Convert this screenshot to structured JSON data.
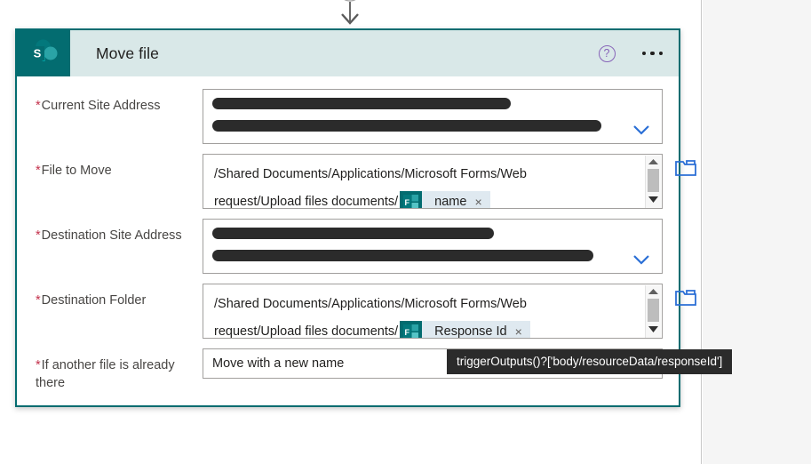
{
  "card": {
    "title": "Move file",
    "connector_icon": "sharepoint-icon",
    "help_glyph": "?",
    "menu_glyph": "overflow-menu-icon",
    "accent_color": "#036c70",
    "header_bg": "#d9e8e8"
  },
  "fields": [
    {
      "id": "current-site-address",
      "label": "Current Site Address",
      "required": true,
      "type": "combo-redacted",
      "value": "",
      "redacted_lines": 2,
      "chevron": "chevron-down-icon"
    },
    {
      "id": "file-to-move",
      "label": "File to Move",
      "required": true,
      "type": "path-token",
      "path_line1": "/Shared Documents/Applications/Microsoft Forms/Web",
      "path_line2": "request/Upload files documents/",
      "token_label": "name",
      "token_icon": "microsoft-forms-icon",
      "token_remove": "×",
      "has_scrollbar": true,
      "folder_button": "folder-picker-icon"
    },
    {
      "id": "destination-site-address",
      "label": "Destination Site Address",
      "required": true,
      "type": "combo-redacted",
      "value": "",
      "redacted_lines": 2,
      "chevron": "chevron-down-icon"
    },
    {
      "id": "destination-folder",
      "label": "Destination Folder",
      "required": true,
      "type": "path-token",
      "path_line1": "/Shared Documents/Applications/Microsoft Forms/Web",
      "path_line2": "request/Upload files documents/",
      "token_label": "Response Id",
      "token_icon": "microsoft-forms-icon",
      "token_remove": "×",
      "has_scrollbar": true,
      "folder_button": "folder-picker-icon"
    },
    {
      "id": "if-another-file-is-already-there",
      "label": "If another file is already there",
      "required": true,
      "type": "text",
      "value": "Move with a new name"
    }
  ],
  "tooltip": {
    "text": "triggerOutputs()?['body/resourceData/responseId']"
  }
}
